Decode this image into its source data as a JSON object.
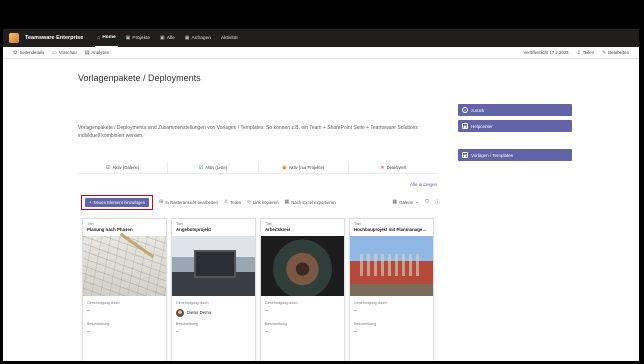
{
  "topnav": {
    "site_title": "Teamsware Enterprise",
    "items": [
      {
        "label": "Home",
        "icon": "home-icon",
        "glyph": "⌂",
        "active": true
      },
      {
        "label": "Projekte",
        "icon": "folder-icon",
        "glyph": "▣",
        "active": false
      },
      {
        "label": "Alle",
        "icon": "folder-icon",
        "glyph": "▣",
        "active": false
      },
      {
        "label": "Anfragen",
        "icon": "folder-icon",
        "glyph": "▣",
        "active": false
      },
      {
        "label": "Aktivität",
        "icon": "",
        "glyph": "",
        "active": false
      }
    ]
  },
  "cmdbar": {
    "page_details": "Seitendetails",
    "preview": "Vorschau",
    "analytics": "Analysen",
    "published": "Veröffentlicht 17.2.2023",
    "share": "Teilen",
    "edit": "Bearbeiten"
  },
  "page": {
    "title": "Vorlagenpakete / Deployments",
    "description": "Vorlagenpakete / Deployments sind Zusammenstellungen von Vorlagen / Templates. So können z.B. ein Team + SharePoint Seite + Teamsware Solutions individuell kombiniert werden."
  },
  "tabs": [
    {
      "label": "Aktiv (Galerie)",
      "icon": "check-icon",
      "glyph": "☑",
      "color": "#2e7d32"
    },
    {
      "label": "Aktiv (Liste)",
      "icon": "check-icon",
      "glyph": "☑",
      "color": "#2e7d32"
    },
    {
      "label": "Aktiv (nur Projekte)",
      "icon": "folder-icon",
      "glyph": "▣",
      "color": "#d98a1c"
    },
    {
      "label": "Deaktiviert",
      "icon": "close-icon",
      "glyph": "✕",
      "color": "#c62828"
    }
  ],
  "show_all": "Alle anzeigen",
  "toolbar": {
    "new_item": "Neues Element hinzufügen",
    "grid_edit": "In Rasteransicht bearbeiten",
    "share": "Teilen",
    "copy_link": "Link kopieren",
    "export_excel": "Nach Excel exportieren",
    "view": "Galerie"
  },
  "card_labels": {
    "title_label": "Titel",
    "approval_label": "Genehmigung durch",
    "description_label": "Beschreibung",
    "empty": "–"
  },
  "cards": [
    {
      "title": "Planung nach Phasen",
      "approver": ""
    },
    {
      "title": "Angebotsprojekt",
      "approver": "Dieter Demo"
    },
    {
      "title": "Arbeitskreis",
      "approver": ""
    },
    {
      "title": "Hochbauprojekt mit Planmanagem...",
      "approver": ""
    }
  ],
  "rightpanel": {
    "back": "zurück",
    "helpcenter": "Helpcenter",
    "templates": "Vorlagen / Templates"
  },
  "colors": {
    "accent": "#6264a7",
    "highlight_box": "#d0021b",
    "topnav_bg": "#201f1e"
  }
}
